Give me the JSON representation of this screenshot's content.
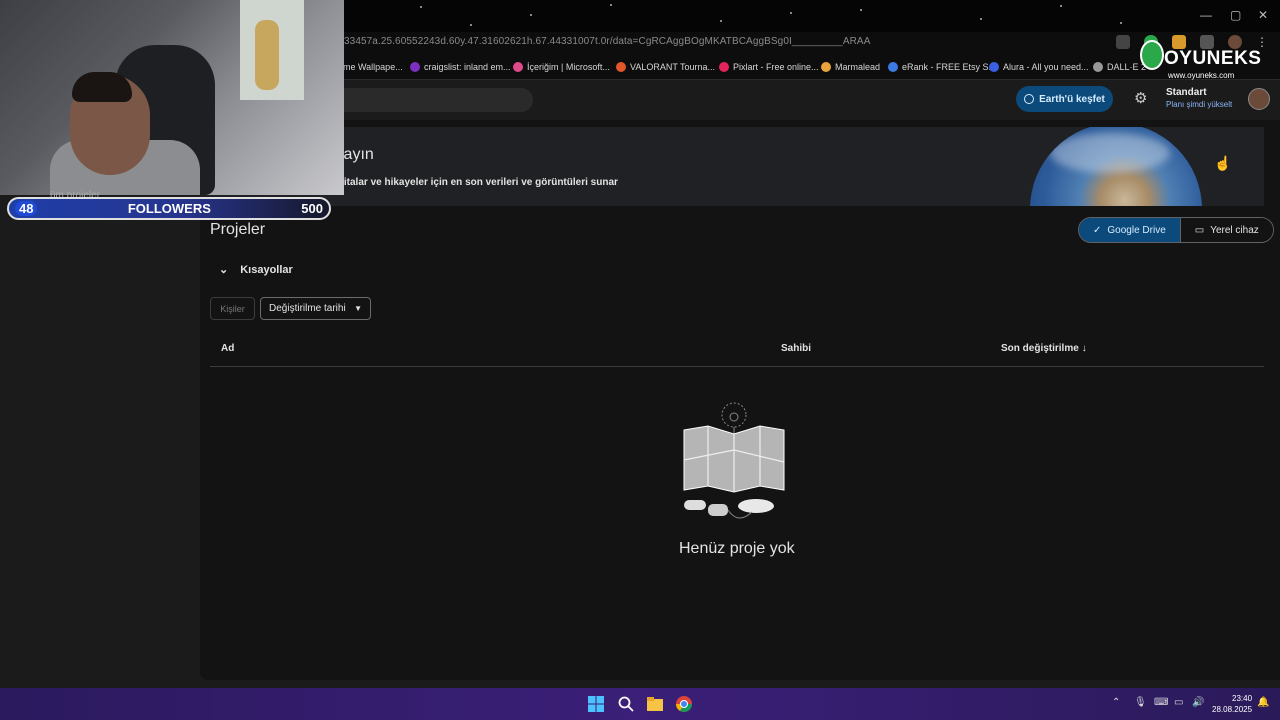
{
  "browser": {
    "url": "33457a.25.60552243d.60y.47.31602621h.67.44331007t.0r/data=CgRCAggBOgMKATBCAggBSg0I_________ARAA",
    "bookmarks": [
      {
        "label": "ome Wallpape...",
        "color": "#888888"
      },
      {
        "label": "craigslist: inland em...",
        "color": "#7b2fbf"
      },
      {
        "label": "İçeriğim | Microsoft...",
        "color": "#e04a8a"
      },
      {
        "label": "VALORANT Tourna...",
        "color": "#e2572a"
      },
      {
        "label": "Pixlart - Free online...",
        "color": "#e2245a"
      },
      {
        "label": "Marmalead",
        "color": "#e8a33a"
      },
      {
        "label": "eRank - FREE Etsy S...",
        "color": "#3a7ae2"
      },
      {
        "label": "Alura - All you need...",
        "color": "#3a5fe2"
      },
      {
        "label": "DALL·E 2",
        "color": "#999999"
      }
    ]
  },
  "appbar": {
    "earth_button": "Earth'ü keşfet",
    "plan_title": "Standart",
    "plan_upgrade": "Planı şimdi yükselt"
  },
  "banner": {
    "title": "layın",
    "subtitle": "ritalar ve hikayeler için en son verileri ve görüntüleri sunar"
  },
  "projects": {
    "title": "Projeler",
    "toggle_drive": "Google Drive",
    "toggle_local": "Yerel cihaz",
    "shortcuts": "Kısayollar",
    "filter_people": "Kişiler",
    "filter_modified": "Değiştirilme tarihi",
    "col_name": "Ad",
    "col_owner": "Sahibi",
    "col_modified": "Son değiştirilme",
    "empty_text": "Henüz proje yok"
  },
  "stream": {
    "followers_current": "48",
    "followers_label": "FOLLOWERS",
    "followers_goal": "500",
    "sidebar_partial": "üm projeler"
  },
  "watermark": {
    "brand": "OYUNEKS",
    "url": "www.oyuneks.com"
  },
  "taskbar": {
    "time": "23:40",
    "date": "28.08.2025"
  }
}
